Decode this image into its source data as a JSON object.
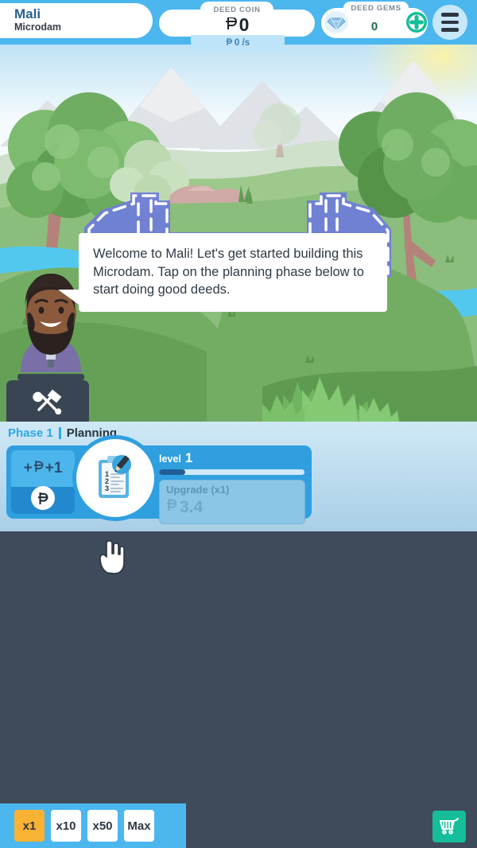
{
  "topbar": {
    "city_name": "Mali",
    "city_sub": "Microdam",
    "coin_label": "DEED COIN",
    "coin_amount": "0",
    "coin_rate": "0 /s",
    "gems_label": "DEED GEMS",
    "gems_amount": "0",
    "gem_icon": "diamond-icon",
    "gem_plus_icon": "plus-circle-icon",
    "menu_icon": "hamburger-menu-icon",
    "accent_blue": "#4cb6ef",
    "gem_green": "#15bd9a"
  },
  "scene": {
    "tutorial_text": "Welcome to Mali! Let's get started building this Microdam. Tap on the planning phase below to start doing good deeds.",
    "tools_icon": "hammer-wrench-icon",
    "blueprint_name": "microdam-blueprint",
    "advisor_name": "advisor-character"
  },
  "phase": {
    "number_label": "Phase 1",
    "name_label": "Planning",
    "tap_reward": "+1",
    "tap_coin_icon": "deed-coin-icon",
    "clipboard_icon": "clipboard-pencil-icon",
    "level_word": "level",
    "level_value": "1",
    "progress_percent": 18,
    "upgrade_label": "Upgrade (x1)",
    "upgrade_cost": "3.4"
  },
  "cursor": {
    "icon": "pointing-hand-cursor"
  },
  "bottombar": {
    "multipliers": [
      {
        "label": "x1",
        "active": true
      },
      {
        "label": "x10",
        "active": false
      },
      {
        "label": "x50",
        "active": false
      },
      {
        "label": "Max",
        "active": false
      }
    ],
    "shop_icon": "shopping-cart-icon"
  }
}
